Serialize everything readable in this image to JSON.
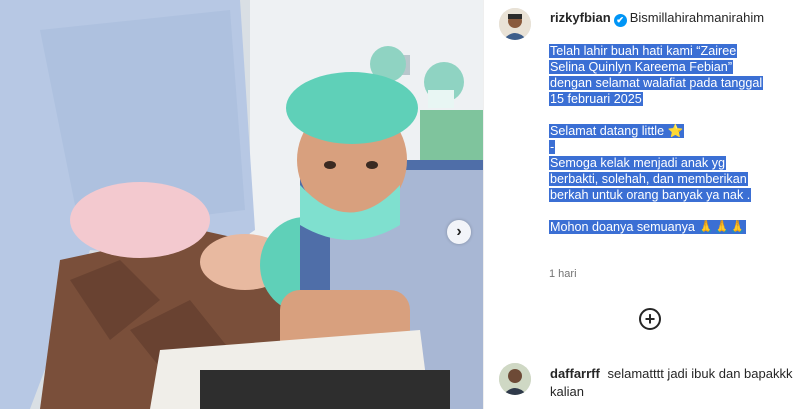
{
  "post": {
    "author": "rizkyfbian",
    "verified_mark": "✔",
    "first_line": "Bismillahirahmanirahim",
    "caption_lines": [
      "Telah lahir buah hati kami “Zairee",
      "Selina Quinlyn Kareema Febian”",
      "dengan selamat walafiat pada tanggal",
      "15 februari 2025",
      "",
      "Selamat datang little ⭐",
      "-",
      "Semoga kelak menjadi anak yg",
      "berbakti, solehah, dan memberikan",
      "berkah untuk orang banyak ya nak .",
      "",
      "Mohon doanya semuanya 🙏🙏🙏"
    ],
    "time_ago": "1 hari",
    "more_comments_icon": "+",
    "next_icon": "›"
  },
  "comment": {
    "author": "daffarrff",
    "text": "selamatttt jadi ibuk dan bapakkk kalian"
  },
  "colors": {
    "highlight": "#3b6fd4",
    "verified": "#0095f6",
    "scrub_cap": "#5fd0b8"
  }
}
